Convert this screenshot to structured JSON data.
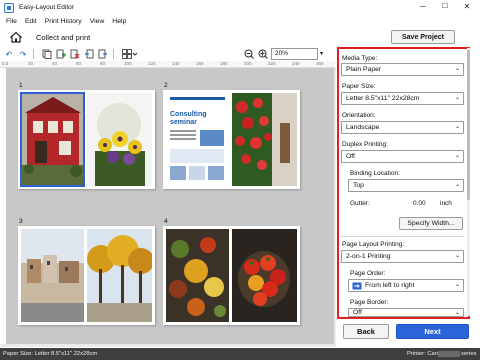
{
  "window": {
    "title": "Easy-Layout Editor",
    "minimize": "─",
    "maximize": "☐",
    "close": "✕"
  },
  "menu": [
    "File",
    "Edit",
    "Print History",
    "View",
    "Help"
  ],
  "nav": {
    "breadcrumb": "Collect and print",
    "save_label": "Save Project"
  },
  "toolbar": {
    "zoom_value": "20%",
    "zoom_arrow": "▾"
  },
  "ruler": {
    "left_label": "0.0",
    "ticks": [
      "20",
      "40",
      "60",
      "80",
      "100",
      "120",
      "140",
      "160",
      "180",
      "200",
      "220",
      "240",
      "260"
    ]
  },
  "pages": [
    {
      "number": "1"
    },
    {
      "number": "2",
      "doc_title_line1": "Consulting",
      "doc_title_line2": "seminar"
    },
    {
      "number": "3"
    },
    {
      "number": "4"
    }
  ],
  "panel": {
    "media_type_label": "Media Type:",
    "media_type_value": "Plain Paper",
    "paper_size_label": "Paper Size:",
    "paper_size_value": "Letter 8.5\"x11\" 22x28cm",
    "orientation_label": "Orientation:",
    "orientation_value": "Landscape",
    "duplex_label": "Duplex Printing:",
    "duplex_value": "Off",
    "binding_label": "Binding Location:",
    "binding_value": "Top",
    "gutter_label": "Gutter:",
    "gutter_value": "0.00",
    "gutter_unit": "inch",
    "specify_width_label": "Specify Width...",
    "page_layout_label": "Page Layout Printing:",
    "page_layout_value": "2-on-1 Printing",
    "page_order_label": "Page Order:",
    "page_order_value": "From left to right",
    "page_border_label": "Page Border:",
    "page_border_value": "Off",
    "caret": "⌄"
  },
  "footer": {
    "back_label": "Back",
    "next_label": "Next"
  },
  "status": {
    "left": "Paper Size: Letter 8.5\"x11\" 22x28cm",
    "right": "Printer: Canon",
    "right_suffix": "series"
  },
  "colors": {
    "accent_blue": "#2b63d9",
    "panel_outline": "#e02020",
    "selection": "#2f5fd0"
  }
}
